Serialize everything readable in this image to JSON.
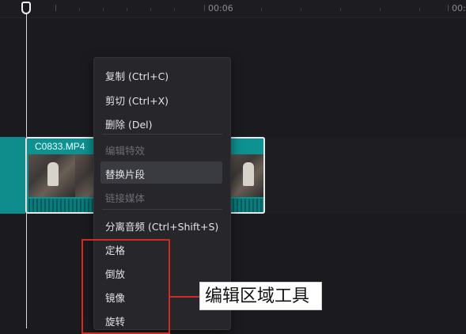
{
  "timeline": {
    "ruler_labels": [
      "00:06",
      "00:"
    ],
    "clip_name": "C0833.MP4"
  },
  "context_menu": {
    "items": [
      {
        "label": "复制 (Ctrl+C)",
        "enabled": true
      },
      {
        "label": "剪切 (Ctrl+X)",
        "enabled": true
      },
      {
        "label": "删除 (Del)",
        "enabled": true
      },
      {
        "label": "编辑特效",
        "enabled": false
      },
      {
        "label": "替换片段",
        "enabled": true,
        "highlighted": true
      },
      {
        "label": "链接媒体",
        "enabled": false
      },
      {
        "label": "分离音频 (Ctrl+Shift+S)",
        "enabled": true
      },
      {
        "label": "定格",
        "enabled": true
      },
      {
        "label": "倒放",
        "enabled": true
      },
      {
        "label": "镜像",
        "enabled": true
      },
      {
        "label": "旋转",
        "enabled": true
      }
    ]
  },
  "annotation": {
    "label": "编辑区域工具",
    "color": "#d42a1d"
  },
  "colors": {
    "background": "#1b1b1f",
    "clip_teal": "#0e9191",
    "menu_bg": "#26262b"
  }
}
